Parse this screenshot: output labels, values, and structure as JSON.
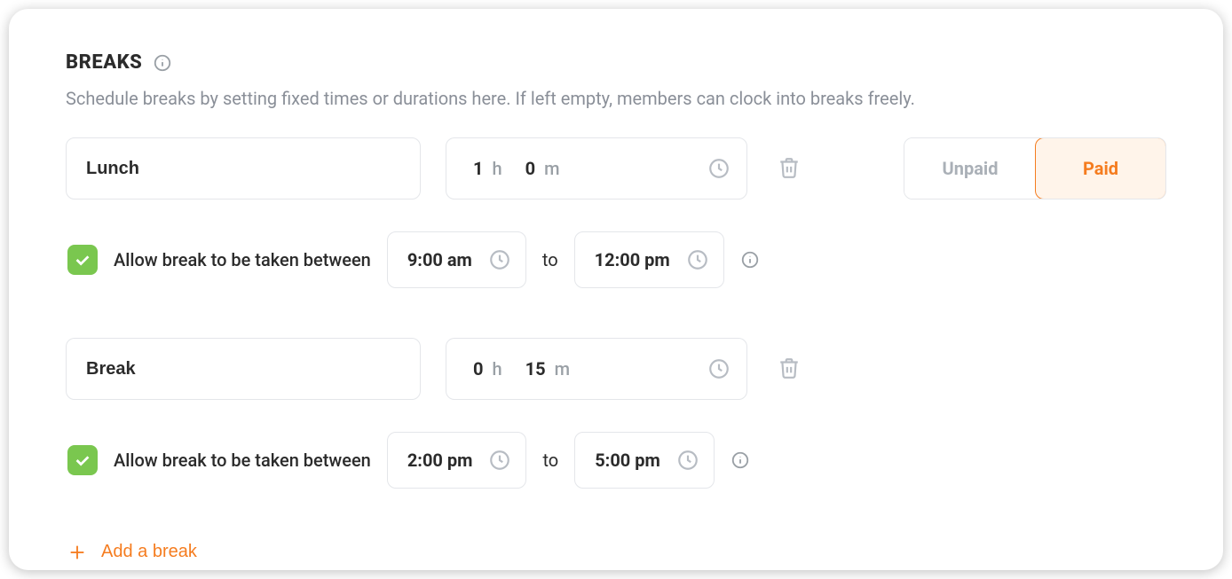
{
  "section": {
    "title": "BREAKS",
    "description": "Schedule breaks by setting fixed times or durations here. If left empty, members can clock into breaks freely."
  },
  "payToggle": {
    "unpaid": "Unpaid",
    "paid": "Paid",
    "selected": "paid"
  },
  "breaks": [
    {
      "name": "Lunch",
      "hours": "1",
      "minutes": "0",
      "allowBetween": {
        "checked": true,
        "label": "Allow break to be taken between",
        "start": "9:00 am",
        "to": "to",
        "end": "12:00 pm"
      }
    },
    {
      "name": "Break",
      "hours": "0",
      "minutes": "15",
      "allowBetween": {
        "checked": true,
        "label": "Allow break to be taken between",
        "start": "2:00 pm",
        "to": "to",
        "end": "5:00 pm"
      }
    }
  ],
  "units": {
    "h": "h",
    "m": "m"
  },
  "addBreak": "Add a break"
}
